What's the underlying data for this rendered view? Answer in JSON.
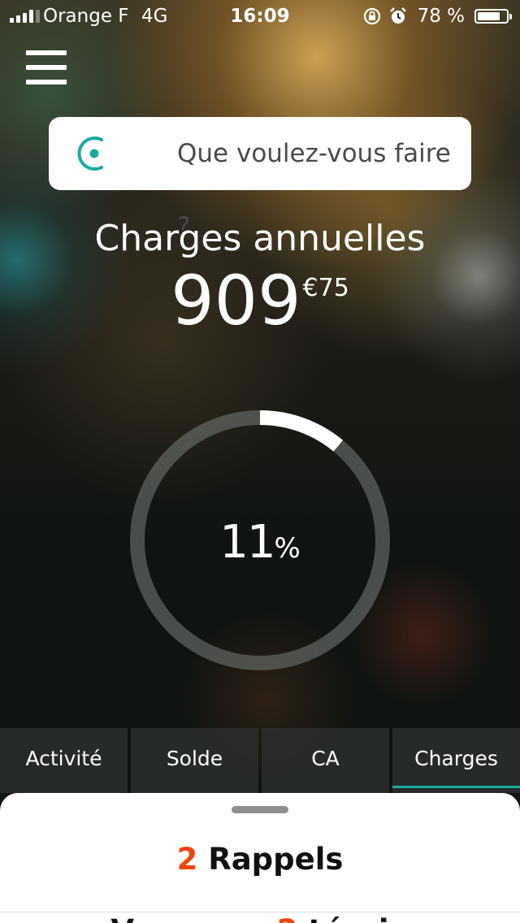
{
  "status_bar": {
    "carrier": "Orange F",
    "network": "4G",
    "time": "16:09",
    "battery_percent": "78 %",
    "battery_level": 0.78,
    "icons": [
      "signal-icon",
      "rotation-lock-icon",
      "alarm-icon",
      "battery-icon"
    ]
  },
  "search": {
    "placeholder": "Que voulez-vous faire ?",
    "icon": "assistant-icon",
    "accent": "#1aa9a2"
  },
  "summary": {
    "title": "Charges annuelles",
    "amount_int": "909",
    "amount_dec": "€75"
  },
  "gauge": {
    "value": "11",
    "unit": "%",
    "fraction": 0.11
  },
  "tabs": [
    {
      "label": "Activité",
      "active": false
    },
    {
      "label": "Solde",
      "active": false
    },
    {
      "label": "CA",
      "active": false
    },
    {
      "label": "Charges",
      "active": true
    }
  ],
  "sheet": {
    "reminders_count": "2",
    "reminders_label": "Rappels",
    "next_line_start": "V",
    "next_line_count": "2",
    "next_line_end": "téorie"
  },
  "colors": {
    "accent": "#1aa9a2",
    "highlight": "#f0450f"
  }
}
